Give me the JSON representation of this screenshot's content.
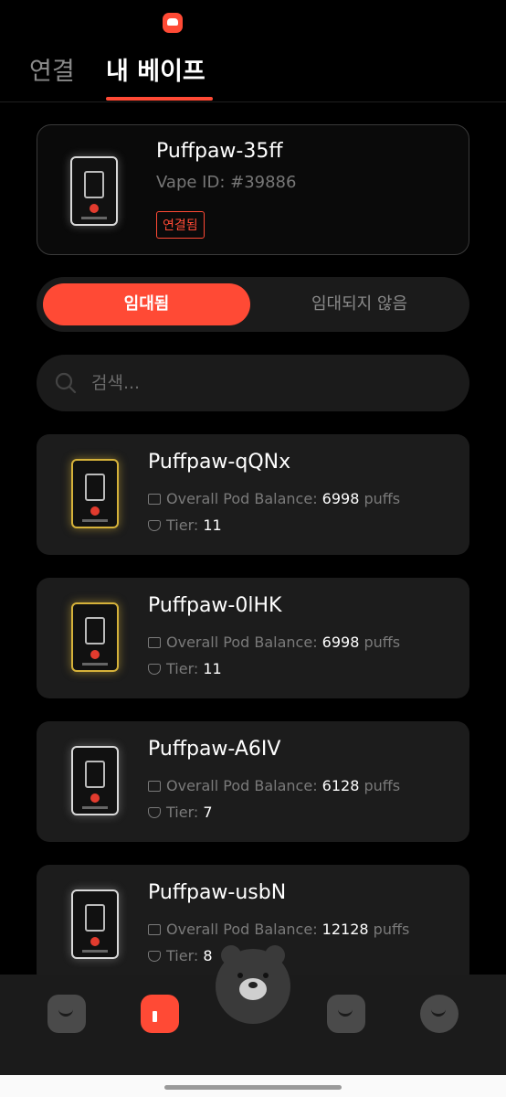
{
  "header": {
    "tabs": [
      {
        "label": "연결",
        "active": false
      },
      {
        "label": "내 베이프",
        "active": true
      }
    ]
  },
  "connected_device": {
    "name": "Puffpaw-35ff",
    "vape_id": "Vape ID: #39886",
    "status": "연결됨"
  },
  "segment": {
    "rented": "임대됨",
    "not_rented": "임대되지 않음"
  },
  "search": {
    "placeholder": "검색..."
  },
  "labels": {
    "balance": "Overall Pod Balance: ",
    "puffs": " puffs",
    "tier": "Tier: "
  },
  "vapes": [
    {
      "name": "Puffpaw-qQNx",
      "balance": "6998",
      "tier": "11",
      "style": "gold"
    },
    {
      "name": "Puffpaw-0lHK",
      "balance": "6998",
      "tier": "11",
      "style": "gold"
    },
    {
      "name": "Puffpaw-A6IV",
      "balance": "6128",
      "tier": "7",
      "style": "silver"
    },
    {
      "name": "Puffpaw-usbN",
      "balance": "12128",
      "tier": "8",
      "style": "silver"
    }
  ],
  "colors": {
    "accent": "#ff4a35",
    "background": "#000000",
    "card": "#1c1c1c"
  },
  "bottom_nav": {
    "icons": [
      "chat-bubble-icon",
      "device-icon",
      "bear-avatar-icon",
      "bag-icon",
      "cloud-icon"
    ]
  }
}
